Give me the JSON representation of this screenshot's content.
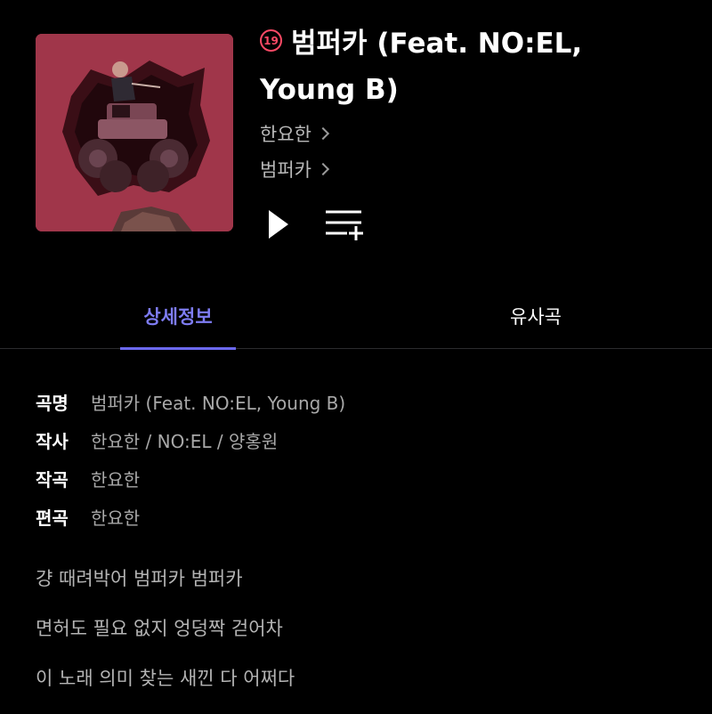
{
  "song": {
    "age_rating": "19",
    "title_line1": "범퍼카 (Feat. NO:EL,",
    "title_line2": "Young B)",
    "artist": "한요한",
    "album": "범퍼카"
  },
  "controls": {
    "play_icon": "play-icon",
    "queue_icon": "add-to-playlist-icon"
  },
  "tabs": [
    {
      "label": "상세정보",
      "active": true
    },
    {
      "label": "유사곡",
      "active": false
    }
  ],
  "details": [
    {
      "label": "곡명",
      "value": "범퍼카 (Feat. NO:EL, Young B)"
    },
    {
      "label": "작사",
      "value": "한요한 / NO:EL / 양홍원"
    },
    {
      "label": "작곡",
      "value": "한요한"
    },
    {
      "label": "편곡",
      "value": "한요한"
    }
  ],
  "lyrics": [
    "걍 때려박어 범퍼카 범퍼카",
    "면허도 필요 없지 엉덩짝 걷어차",
    "이 노래 의미 찾는 새낀 다 어쩌다"
  ],
  "colors": {
    "background": "#000000",
    "accent": "#6b68f0",
    "age_badge": "#ff4a66",
    "cover_bg": "#a0364a"
  }
}
